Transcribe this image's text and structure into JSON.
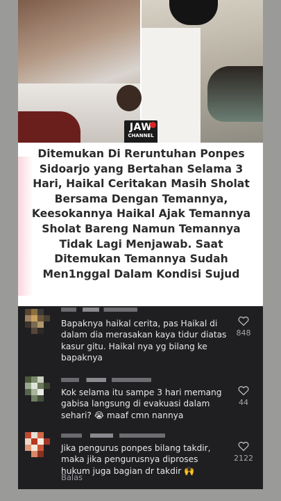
{
  "logo": {
    "line1": "JAW",
    "line2": "CHANNEL"
  },
  "headline": "Ditemukan Di Reruntuhan Ponpes Sidoarjo yang Bertahan Selama 3 Hari, Haikal Ceritakan Masih Sholat Bersama Dengan Temannya, Keesokannya Haikal Ajak Temannya Sholat Bareng Namun Temannya Tidak Lagi Menjawab. Saat Ditemukan Temannya Sudah Men1nggal Dalam Kondisi Sujud",
  "comments": [
    {
      "text": "Bapaknya haikal cerita, pas Haikal di dalam dia merasakan kaya tidur diatas kasur gitu. Haikal nya yg bilang ke bapaknya",
      "likes": "848"
    },
    {
      "text": "Kok selama itu sampe 3 hari memang gabisa langsung di evakuasi dalam sehari? 😭 maaf cmn nannya",
      "likes": "44"
    },
    {
      "text": "Jika pengurus ponpes bilang takdir, maka jika pengurusnya diproses hukum juga bagian dr takdir 🙌",
      "likes": "2122",
      "reply_label": "Balas"
    }
  ],
  "colors": {
    "comment_bg": "#1f1f21",
    "headline_text": "#2b2b2b",
    "like_count": "#a8a8ac"
  },
  "icons": [
    "heart-icon",
    "avatar"
  ]
}
